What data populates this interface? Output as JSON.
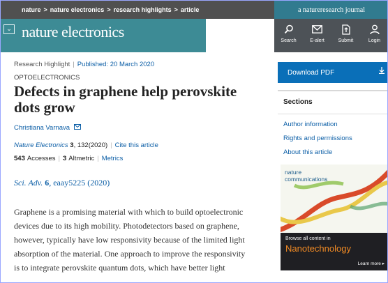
{
  "breadcrumbs": [
    "nature",
    "nature electronics",
    "research highlights",
    "article"
  ],
  "journal_tag": "a natureresearch journal",
  "brand": {
    "logo": "nature electronics",
    "menu_icon": "chevron-down-icon"
  },
  "toolbar": [
    {
      "label": "Search",
      "icon": "search-icon"
    },
    {
      "label": "E-alert",
      "icon": "mail-icon"
    },
    {
      "label": "Submit",
      "icon": "upload-icon"
    },
    {
      "label": "Login",
      "icon": "user-icon"
    }
  ],
  "article": {
    "type": "Research Highlight",
    "published": "Published: 20 March 2020",
    "subject": "OPTOELECTRONICS",
    "title": "Defects in graphene help perovskite dots grow",
    "author": "Christiana Varnava",
    "citation": {
      "journal": "Nature Electronics",
      "volume": "3",
      "pages": ", 132(2020)",
      "cite_link": "Cite this article"
    },
    "metrics": {
      "accesses_count": "543",
      "accesses_label": "Accesses",
      "altmetric_count": "3",
      "altmetric_label": "Altmetric",
      "metrics_link": "Metrics"
    },
    "reference": {
      "journal": "Sci. Adv.",
      "volume": "6",
      "rest": ", eaay5225 (2020)"
    },
    "body": "Graphene is a promising material with which to build optoelectronic devices due to its high mobility. Photodetectors based on graphene, however, typically have low responsivity because of the limited light absorption of the material. One approach to improve the responsivity is to integrate perovskite quantum dots, which have better light"
  },
  "sidebar": {
    "download_label": "Download PDF",
    "sections_title": "Sections",
    "section_links": [
      "Author information",
      "Rights and permissions",
      "About this article"
    ]
  },
  "ad": {
    "brand_line1": "nature",
    "brand_line2": "communications",
    "browse": "Browse all content in",
    "topic": "Nanotechnology",
    "more": "Learn more ▸"
  },
  "colors": {
    "header_dark": "#505050",
    "teal": "#3d8b95",
    "journal_teal": "#317b8f",
    "link": "#0b5ea6",
    "download": "#0a6fb8"
  }
}
